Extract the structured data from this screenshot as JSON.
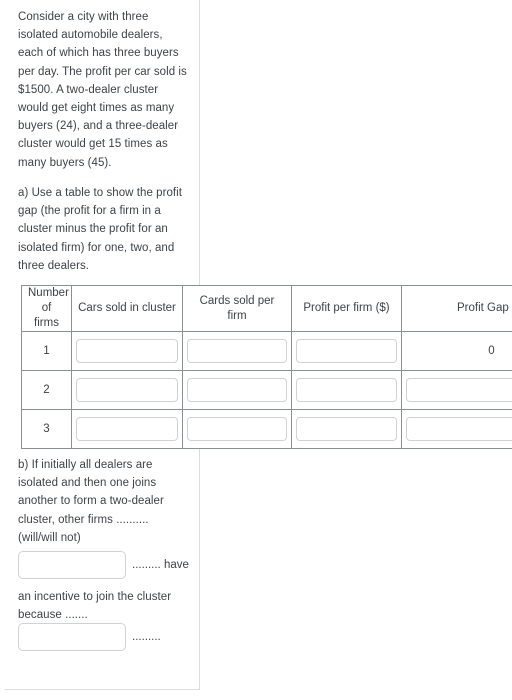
{
  "document": {
    "intro_paragraph": "Consider a city with three isolated automobile dealers, each of which has three buyers per day. The profit per car sold is $1500. A two-dealer cluster would get eight times as many buyers (24), and a three-dealer cluster would get 15 times as many buyers (45).",
    "part_a_prompt": "a) Use a table to show the profit gap (the profit for a firm in a cluster minus the profit for an isolated firm) for one, two, and three dealers.",
    "part_b_prompt": "b) If initially all dealers are isolated and then one joins another to form a two-dealer cluster, other firms .......... (will/will not)",
    "part_b_continuation": "an incentive to join the cluster because .......",
    "answer_1_tail": "......... have",
    "answer_2_tail": ".........",
    "answer_1_value": "",
    "answer_2_value": "",
    "answer_placeholder": ""
  },
  "table": {
    "headers": [
      "Number of firms",
      "Cars sold in cluster",
      "Cards sold per firm",
      "Profit per firm ($)",
      "Profit Gap ($)"
    ],
    "rows": [
      {
        "firms": "1",
        "cars_in_cluster": "",
        "cards_per_firm": "",
        "profit_per_firm": "",
        "profit_gap_static": "0",
        "gap_is_input": false
      },
      {
        "firms": "2",
        "cars_in_cluster": "",
        "cards_per_firm": "",
        "profit_per_firm": "",
        "profit_gap_static": "",
        "gap_is_input": true
      },
      {
        "firms": "3",
        "cars_in_cluster": "",
        "cards_per_firm": "",
        "profit_per_firm": "",
        "profit_gap_static": "",
        "gap_is_input": true
      }
    ],
    "cell_placeholder": ""
  },
  "colors": {
    "text": "#3d4247",
    "table_border": "#8a8f94",
    "input_border": "#cfd2d5",
    "card_border": "#dcdcdc",
    "background": "#ffffff"
  }
}
